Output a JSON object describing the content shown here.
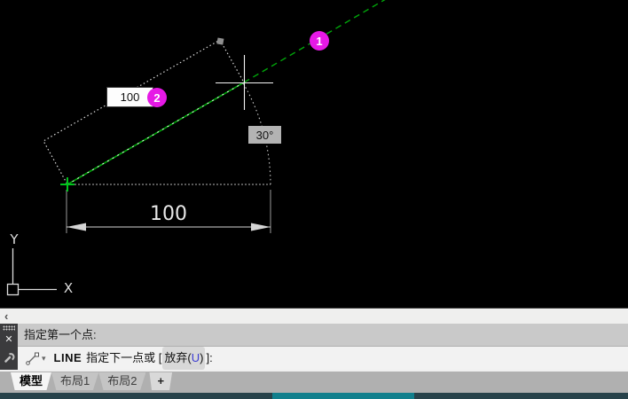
{
  "canvas": {
    "badge1": "1",
    "badge2": "2",
    "dynamic_input_value": "100",
    "angle_readout": "30°",
    "dimension_text": "100",
    "ucs": {
      "x_label": "X",
      "y_label": "Y"
    },
    "colors": {
      "line_green": "#00a50a",
      "snap_green": "#00c41c",
      "badge_magenta": "#e619e6",
      "angle_box_bg": "#b3b3b3",
      "dimension_gray": "#d5d5d5"
    }
  },
  "scrollbar": {
    "left_arrow": "‹"
  },
  "command_window": {
    "close_label": "✕",
    "history_line": "指定第一个点:",
    "prompt": {
      "command": "LINE",
      "text_before_options": "指定下一点或 [",
      "option_name": "放弃(",
      "option_key": "U",
      "option_close": ")",
      "text_after_options": "]:"
    },
    "dropdown_caret": "▾"
  },
  "layout_tabs": {
    "tabs": [
      {
        "label": "模型",
        "active": true
      },
      {
        "label": "布局1",
        "active": false
      },
      {
        "label": "布局2",
        "active": false
      }
    ],
    "add_tab_label": "+"
  }
}
